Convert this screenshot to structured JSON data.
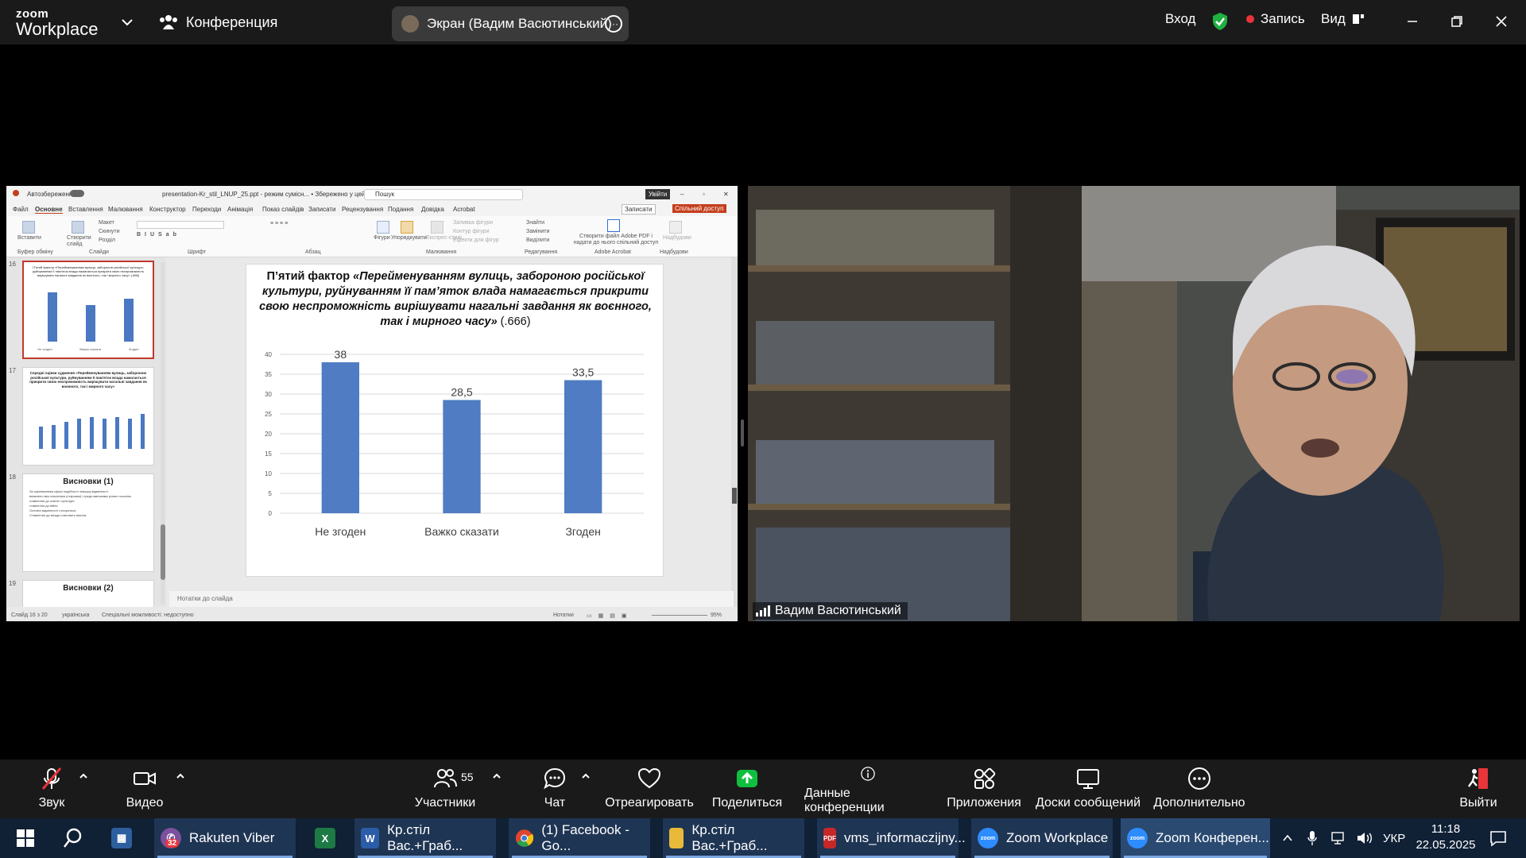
{
  "topbar": {
    "logo_line1": "zoom",
    "logo_line2": "Workplace",
    "meeting_label": "Конференция",
    "screen_share_label": "Экран (Вадим Васютинський)",
    "signin": "Вход",
    "record": "Запись",
    "view": "Вид"
  },
  "powerpoint": {
    "autosave": "Автозбереження",
    "filename": "presentation-Kr_stil_LNUP_25.ppt  -  режим сумісн...  •  Збережено у цей ПК",
    "search_placeholder": "Пошук",
    "signin": "Увійти",
    "tabs": [
      "Файл",
      "Основне",
      "Вставлення",
      "Малювання",
      "Конструктор",
      "Переходи",
      "Анімація",
      "Показ слайдів",
      "Записати",
      "Рецензування",
      "Подання",
      "Довідка",
      "Acrobat"
    ],
    "record_btn": "Записати",
    "share_btn": "Спільний доступ",
    "ribbon_groups": [
      "Буфер обміну",
      "Слайди",
      "Шрифт",
      "Абзац",
      "Малювання",
      "Редагування",
      "Adobe Acrobat",
      "Надбудови"
    ],
    "ribbon_items": {
      "paste": "Вставити",
      "new_slide": "Створити слайд",
      "layout": "Макет",
      "reset": "Скинути",
      "section": "Розділ",
      "shapes": "Фігури",
      "arrange": "Упорядкувати",
      "quick_styles": "Експрес-стилі",
      "fill": "Заливка фігури",
      "outline": "Контур фігури",
      "effects": "Ефекти для фігур",
      "find": "Знайти",
      "replace": "Замінити",
      "select": "Виділити",
      "adobe": "Створити файл Adobe PDF і надати до нього спільний доступ",
      "addins": "Надбудови"
    },
    "thumbnails": [
      {
        "num": "16",
        "title": "П'ятий фактор «Перейменуванням вулиць, забороною російської культури, руйнуванням її пам'яток влада намагається прикрити свою неспроможність вирішувати нагальні завдання як воєнного, так і мирного часу» (.666)",
        "labels": [
          "Не згоден",
          "Важко сказати",
          "Згоден"
        ],
        "values": [
          38,
          28.5,
          33.5
        ]
      },
      {
        "num": "17",
        "title": "Середні оцінки судження «Перейменуванням вулиць, забороною російської культури, руйнуванням її пам'яток влада намагається прикрити свою неспроможність вирішувати нагальні завдання як воєнного, так і мирного часу»"
      },
      {
        "num": "18",
        "title": "Висновки (1)",
        "lines": [
          "За оцінюванням сфері подібності значущі відмінності",
          "виявлено між кількісним (старшим) і представниками різних поколінь",
          "ставлення до освіти і культури",
          "ставлення до війни",
          "Основні відмінності стосуються",
          "Ставлення до влади становить виклик"
        ]
      },
      {
        "num": "19",
        "title": "Висновки (2)"
      }
    ],
    "slide": {
      "title_prefix": "П’ятий фактор ",
      "title_italic": "«Перейменуванням вулиць, забороною російської культури, руйнуванням її пам’яток влада намагається прикрити свою неспроможність вирішувати нагальні завдання як воєнного, так і мирного часу»",
      "title_suffix": " (.666)"
    },
    "notes_placeholder": "Нотатки до слайда",
    "status": {
      "slide": "Слайд 16 з 20",
      "lang": "українська",
      "accessibility": "Спеціальні можливості: недоступно",
      "notes": "Нотатки",
      "zoom": "95%"
    }
  },
  "chart_data": {
    "type": "bar",
    "categories": [
      "Не згоден",
      "Важко сказати",
      "Згоден"
    ],
    "values": [
      38,
      28.5,
      33.5
    ],
    "value_labels": [
      "38",
      "28,5",
      "33,5"
    ],
    "ylim": [
      0,
      40
    ],
    "yticks": [
      0,
      5,
      10,
      15,
      20,
      25,
      30,
      35,
      40
    ],
    "color": "#4f7cc3",
    "grid": true
  },
  "video": {
    "participant_name": "Вадим Васютинський"
  },
  "toolbar": {
    "audio": "Звук",
    "video": "Видео",
    "participants": "Участники",
    "participants_count": "55",
    "chat": "Чат",
    "react": "Отреагировать",
    "share": "Поделиться",
    "meeting_info": "Данные конференции",
    "apps": "Приложения",
    "whiteboards": "Доски сообщений",
    "more": "Дополнительно",
    "leave": "Выйти",
    "share_color": "#0fbf3f",
    "leave_color": "#e8353a"
  },
  "taskbar": {
    "viber": "Rakuten Viber",
    "viber_badge": "32",
    "word": "Кр.стіл Вас.+Граб...",
    "chrome": "(1) Facebook - Go...",
    "folder": "Кр.стіл Вас.+Граб...",
    "pdf": "vms_informaczijny...",
    "zoom1": "Zoom Workplace",
    "zoom2": "Zoom Конферен...",
    "lang": "УКР",
    "time": "11:18",
    "date": "22.05.2025"
  }
}
